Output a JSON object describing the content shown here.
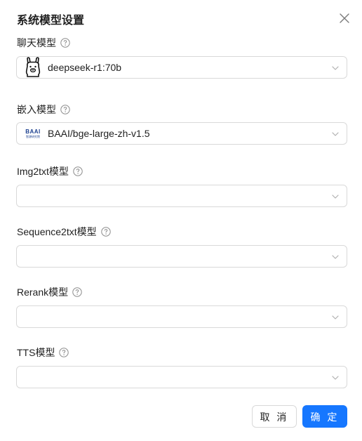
{
  "dialog": {
    "title": "系统模型设置",
    "cancel_label": "取 消",
    "ok_label": "确 定",
    "accent_color": "#1677ff"
  },
  "fields": [
    {
      "label": "聊天模型",
      "value": "deepseek-r1:70b",
      "icon": "ollama-llama-icon"
    },
    {
      "label": "嵌入模型",
      "value": "BAAI/bge-large-zh-v1.5",
      "icon": "baai-logo-icon",
      "icon_text": "BAAI",
      "icon_subtext": "智源研究院"
    },
    {
      "label": "Img2txt模型",
      "value": ""
    },
    {
      "label": "Sequence2txt模型",
      "value": ""
    },
    {
      "label": "Rerank模型",
      "value": ""
    },
    {
      "label": "TTS模型",
      "value": ""
    }
  ]
}
